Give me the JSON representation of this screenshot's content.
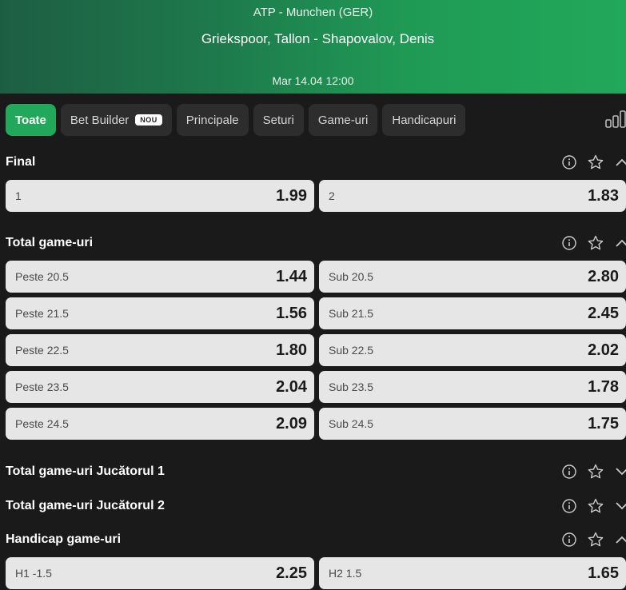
{
  "header": {
    "league": "ATP - Munchen (GER)",
    "match": "Griekspoor, Tallon - Shapovalov, Denis",
    "date": "Mar 14.04 12:00"
  },
  "tabs": [
    {
      "label": "Toate",
      "active": true
    },
    {
      "label": "Bet Builder",
      "badge": "NOU"
    },
    {
      "label": "Principale"
    },
    {
      "label": "Seturi"
    },
    {
      "label": "Game-uri"
    },
    {
      "label": "Handicapuri"
    }
  ],
  "sections": [
    {
      "title": "Final",
      "expanded": true,
      "rows": [
        [
          {
            "label": "1",
            "odd": "1.99"
          },
          {
            "label": "2",
            "odd": "1.83"
          }
        ]
      ]
    },
    {
      "title": "Total game-uri",
      "expanded": true,
      "rows": [
        [
          {
            "label": "Peste 20.5",
            "odd": "1.44"
          },
          {
            "label": "Sub 20.5",
            "odd": "2.80"
          }
        ],
        [
          {
            "label": "Peste 21.5",
            "odd": "1.56"
          },
          {
            "label": "Sub 21.5",
            "odd": "2.45"
          }
        ],
        [
          {
            "label": "Peste 22.5",
            "odd": "1.80"
          },
          {
            "label": "Sub 22.5",
            "odd": "2.02"
          }
        ],
        [
          {
            "label": "Peste 23.5",
            "odd": "2.04"
          },
          {
            "label": "Sub 23.5",
            "odd": "1.78"
          }
        ],
        [
          {
            "label": "Peste 24.5",
            "odd": "2.09"
          },
          {
            "label": "Sub 24.5",
            "odd": "1.75"
          }
        ]
      ]
    },
    {
      "title": "Total game-uri Jucătorul 1",
      "expanded": false,
      "rows": []
    },
    {
      "title": "Total game-uri Jucătorul 2",
      "expanded": false,
      "rows": []
    },
    {
      "title": "Handicap game-uri",
      "expanded": true,
      "rows": [
        [
          {
            "label": "H1 -1.5",
            "odd": "2.25"
          },
          {
            "label": "H2 1.5",
            "odd": "1.65"
          }
        ]
      ]
    }
  ],
  "icons": {
    "info": "info-icon",
    "favorite": "star-icon",
    "collapse": "chevron-up-icon",
    "expand": "chevron-down-icon",
    "stats": "bar-chart-icon"
  },
  "colors": {
    "accent": "#22a85a",
    "background": "#1a1a1a",
    "tab": "#2d2d2d",
    "odd_button": "#e6e6e6"
  }
}
